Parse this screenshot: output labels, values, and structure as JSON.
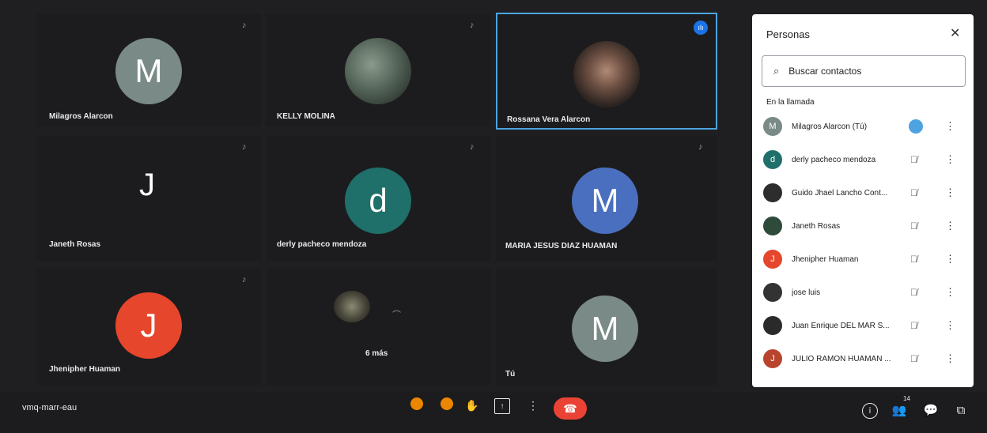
{
  "tiles": [
    {
      "name": "Milagros Alarcon",
      "letter": "M",
      "color": "#7a8a86"
    },
    {
      "name": "KELLY MOLINA"
    },
    {
      "name": "Rossana Vera Alarcon"
    },
    {
      "name": "Janeth Rosas",
      "letter": "J"
    },
    {
      "name": "derly pacheco mendoza",
      "letter": "d",
      "color": "#1f6f6a"
    },
    {
      "name": "MARIA JESUS DIAZ HUAMAN",
      "letter": "M",
      "color": "#4a6fbf"
    },
    {
      "name": "Jhenipher Huaman",
      "letter": "J",
      "color": "#e5462c"
    },
    {
      "name": "6 más"
    },
    {
      "name": "Tú",
      "letter": "M",
      "color": "#7a8a86"
    }
  ],
  "meeting_code": "vmq-marr-eau",
  "participant_count": "14",
  "panel": {
    "title": "Personas",
    "close_symbol": "✕",
    "search_placeholder": "Buscar contactos",
    "section_label": "En la llamada",
    "people": [
      {
        "name": "Milagros Alarcon (Tú)",
        "letter": "M",
        "color": "#7a8a86",
        "state": "speaking"
      },
      {
        "name": "derly pacheco mendoza",
        "letter": "d",
        "color": "#1f6f6a",
        "state": "muted"
      },
      {
        "name": "Guido Jhael Lancho Cont...",
        "letter": "",
        "color": "#2d2d2d",
        "state": "muted"
      },
      {
        "name": "Janeth Rosas",
        "letter": "",
        "color": "#2d4a3a",
        "state": "muted"
      },
      {
        "name": "Jhenipher Huaman",
        "letter": "J",
        "color": "#e5462c",
        "state": "muted"
      },
      {
        "name": "jose luis",
        "letter": "",
        "color": "#333",
        "state": "muted"
      },
      {
        "name": "Juan Enrique DEL MAR S...",
        "letter": "",
        "color": "#2a2a2a",
        "state": "muted"
      },
      {
        "name": "JULIO RAMON HUAMAN ...",
        "letter": "J",
        "color": "#b8442e",
        "state": "muted"
      }
    ]
  },
  "colors": {
    "accent": "#1a73e8",
    "hangup": "#ea4335",
    "orange": "#ea8600"
  }
}
